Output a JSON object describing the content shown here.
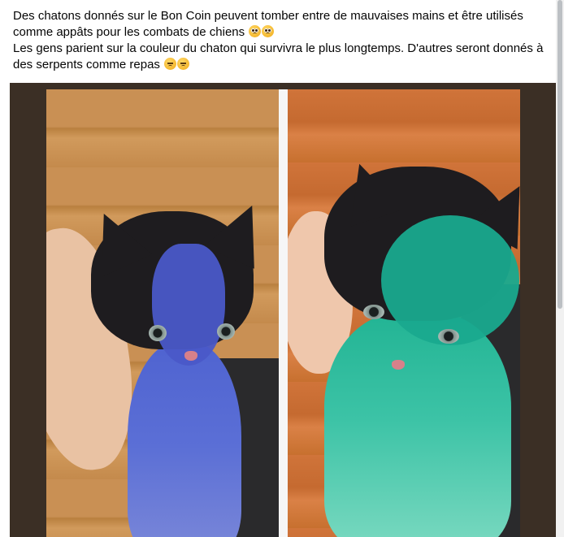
{
  "post": {
    "line1": "Des chatons donnés sur le Bon Coin peuvent tomber entre de mauvaises mains et être utilisés comme appâts pour les combats de chiens",
    "line1_emojis": [
      "pleading-face-emoji",
      "pleading-face-emoji"
    ],
    "line2": "Les gens parient sur la couleur du chaton qui survivra le plus longtemps. D'autres seront donnés à des serpents comme repas",
    "line2_emojis": [
      "pensive-face-emoji",
      "pensive-face-emoji"
    ]
  },
  "photo": {
    "panels": [
      {
        "subject": "kitten-painted-blue",
        "paint_color": "#4a58c8"
      },
      {
        "subject": "kitten-painted-green",
        "paint_color": "#19a98e"
      }
    ]
  },
  "colors": {
    "text": "#050505",
    "frame": "#3b2f25",
    "divider": "#f6f6f6"
  }
}
